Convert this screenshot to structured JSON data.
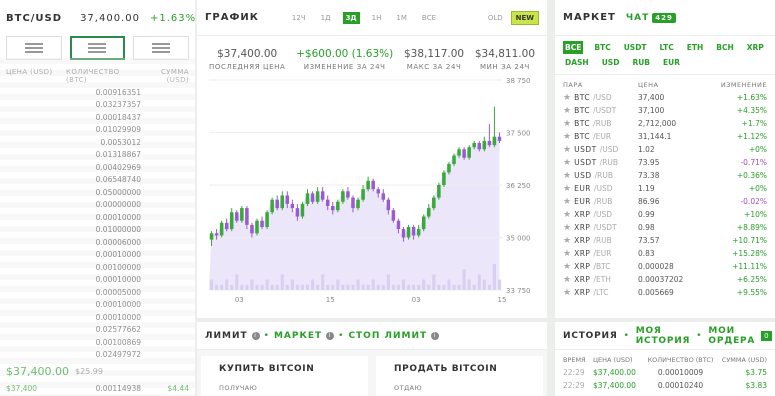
{
  "orderbook": {
    "pair": "BTC/USD",
    "price": "37,400.00",
    "change": "+1.63%",
    "columns": [
      "ЦЕНА (USD)",
      "КОЛИЧЕСТВО (BTC)",
      "СУММА (USD)"
    ],
    "rows": [
      {
        "q": "0.00916351"
      },
      {
        "q": "0.03237357"
      },
      {
        "q": "0.00018437"
      },
      {
        "q": "0.01029909"
      },
      {
        "q": "0.0053012"
      },
      {
        "q": "0.01318867"
      },
      {
        "q": "0.00402969"
      },
      {
        "q": "0.06548740"
      },
      {
        "q": "0.05000000"
      },
      {
        "q": "0.00000000"
      },
      {
        "q": "0.00010000"
      },
      {
        "q": "0.01000000"
      },
      {
        "q": "0.00006000"
      },
      {
        "q": "0.00010000"
      },
      {
        "q": "0.00100000"
      },
      {
        "q": "0.00010000"
      },
      {
        "q": "0.00005000"
      },
      {
        "q": "0.00010000"
      },
      {
        "q": "0.00010000"
      },
      {
        "q": "0.02577662"
      },
      {
        "q": "0.00100869"
      },
      {
        "q": "0.02497972"
      }
    ],
    "mid_price": "$37,400.00",
    "mid_usd": "$25.99",
    "bottom_row": {
      "p": "$37,400",
      "q": "0.00114938",
      "s": "$4.44"
    }
  },
  "chart_panel": {
    "title": "ГРАФИК",
    "ranges": [
      "12Ч",
      "1Д",
      "3Д",
      "1Н",
      "1М",
      "ВСЕ"
    ],
    "active_range": "3Д",
    "old_label": "OLD",
    "new_label": "NEW",
    "stats": [
      {
        "value": "$37,400.00",
        "label": "ПОСЛЕДНЯЯ ЦЕНА",
        "color": "#555"
      },
      {
        "value": "+$600.00 (1.63%)",
        "label": "ИЗМЕНЕНИЕ ЗА 24Ч",
        "color": "#28a028"
      },
      {
        "value": "$38,117.00",
        "label": "МАКС ЗА 24Ч",
        "color": "#555"
      },
      {
        "value": "$34,811.00",
        "label": "МИН ЗА 24Ч",
        "color": "#555"
      }
    ]
  },
  "chart_data": {
    "type": "candlestick",
    "yticks": [
      33750,
      35000,
      36250,
      37500,
      38750
    ],
    "ytick_labels": [
      "33 750",
      "35 000",
      "36 250",
      "37 500",
      "38 750"
    ],
    "ylim": [
      33750,
      38750
    ],
    "xticks": [
      "03",
      "15",
      "03",
      "15"
    ],
    "xtick_index": [
      6,
      24,
      41,
      58
    ],
    "candles": [
      [
        34950,
        35100,
        34800,
        35150
      ],
      [
        35100,
        35050,
        34950,
        35200
      ],
      [
        35050,
        35350,
        35000,
        35400
      ],
      [
        35350,
        35200,
        35150,
        35450
      ],
      [
        35200,
        35600,
        35150,
        35700
      ],
      [
        35600,
        35400,
        35350,
        35650
      ],
      [
        35400,
        35700,
        35350,
        35750
      ],
      [
        35700,
        35300,
        35200,
        35750
      ],
      [
        35300,
        35100,
        35000,
        35350
      ],
      [
        35100,
        35400,
        35050,
        35450
      ],
      [
        35400,
        35250,
        35200,
        35500
      ],
      [
        35250,
        35600,
        35200,
        35650
      ],
      [
        35600,
        35900,
        35550,
        35950
      ],
      [
        35900,
        35700,
        35650,
        36000
      ],
      [
        35700,
        36000,
        35650,
        36100
      ],
      [
        36000,
        35800,
        35700,
        36100
      ],
      [
        35800,
        35700,
        35600,
        35900
      ],
      [
        35700,
        35500,
        35400,
        35800
      ],
      [
        35500,
        35800,
        35450,
        35850
      ],
      [
        35800,
        36050,
        35750,
        36150
      ],
      [
        36050,
        35850,
        35800,
        36100
      ],
      [
        35850,
        36100,
        35800,
        36200
      ],
      [
        36100,
        35900,
        35850,
        36200
      ],
      [
        35900,
        35750,
        35650,
        36000
      ],
      [
        35750,
        35650,
        35550,
        35850
      ],
      [
        35650,
        35850,
        35600,
        35900
      ],
      [
        35850,
        36100,
        35800,
        36150
      ],
      [
        36100,
        35950,
        35900,
        36200
      ],
      [
        35950,
        35700,
        35600,
        36000
      ],
      [
        35700,
        35900,
        35650,
        35950
      ],
      [
        35900,
        36150,
        35850,
        36250
      ],
      [
        36150,
        36350,
        36100,
        36450
      ],
      [
        36350,
        36150,
        36100,
        36400
      ],
      [
        36150,
        36050,
        35950,
        36200
      ],
      [
        36050,
        35900,
        35850,
        36150
      ],
      [
        35900,
        35650,
        35550,
        35950
      ],
      [
        35650,
        35400,
        35350,
        35700
      ],
      [
        35400,
        35200,
        35100,
        35450
      ],
      [
        35200,
        35000,
        34900,
        35250
      ],
      [
        35000,
        35250,
        34950,
        35300
      ],
      [
        35250,
        35050,
        34950,
        35300
      ],
      [
        35050,
        35200,
        35000,
        35300
      ],
      [
        35200,
        35500,
        35150,
        35550
      ],
      [
        35500,
        35700,
        35450,
        35800
      ],
      [
        35700,
        35950,
        35650,
        36000
      ],
      [
        35950,
        36250,
        35900,
        36300
      ],
      [
        36250,
        36550,
        36200,
        36600
      ],
      [
        36550,
        36750,
        36500,
        36800
      ],
      [
        36750,
        36950,
        36700,
        37000
      ],
      [
        36950,
        37100,
        36900,
        37150
      ],
      [
        37100,
        36900,
        36850,
        37150
      ],
      [
        36900,
        37150,
        36850,
        37200
      ],
      [
        37150,
        37250,
        37100,
        37300
      ],
      [
        37250,
        37100,
        37050,
        37300
      ],
      [
        37100,
        37300,
        37050,
        37400
      ],
      [
        37300,
        37200,
        37150,
        37700
      ],
      [
        37200,
        37400,
        37150,
        38117
      ],
      [
        37400,
        37300,
        37250,
        37500
      ]
    ],
    "volumes": [
      2,
      1,
      1,
      2,
      1,
      3,
      1,
      1,
      2,
      1,
      1,
      2,
      1,
      1,
      3,
      1,
      2,
      1,
      1,
      1,
      2,
      1,
      3,
      1,
      1,
      2,
      1,
      1,
      1,
      2,
      1,
      1,
      2,
      1,
      1,
      3,
      1,
      1,
      2,
      1,
      1,
      1,
      2,
      1,
      3,
      1,
      1,
      2,
      1,
      1,
      4,
      2,
      1,
      3,
      2,
      1,
      5,
      2
    ]
  },
  "market": {
    "title": "МАРКЕТ",
    "chat_label": "ЧАТ",
    "chat_count": "429",
    "currencies": [
      "ВСЕ",
      "BTC",
      "USDT",
      "LTC",
      "ETH",
      "BCH",
      "XRP",
      "DASH",
      "USD",
      "RUB",
      "EUR"
    ],
    "active_currency": "ВСЕ",
    "columns": [
      "ПАРА",
      "ЦЕНА",
      "ИЗМЕНЕНИЕ"
    ],
    "rows": [
      {
        "base": "BTC",
        "quote": "/USD",
        "price": "37,400",
        "change": "+1.63%"
      },
      {
        "base": "BTC",
        "quote": "/USDT",
        "price": "37,100",
        "change": "+4.35%"
      },
      {
        "base": "BTC",
        "quote": "/RUB",
        "price": "2,712,000",
        "change": "+1.7%"
      },
      {
        "base": "BTC",
        "quote": "/EUR",
        "price": "31,144.1",
        "change": "+1.12%"
      },
      {
        "base": "USDT",
        "quote": "/USD",
        "price": "1.02",
        "change": "+0%"
      },
      {
        "base": "USDT",
        "quote": "/RUB",
        "price": "73.95",
        "change": "-0.71%"
      },
      {
        "base": "USD",
        "quote": "/RUB",
        "price": "73.38",
        "change": "+0.36%"
      },
      {
        "base": "EUR",
        "quote": "/USD",
        "price": "1.19",
        "change": "+0%"
      },
      {
        "base": "EUR",
        "quote": "/RUB",
        "price": "86.96",
        "change": "-0.02%"
      },
      {
        "base": "XRP",
        "quote": "/USD",
        "price": "0.99",
        "change": "+10%"
      },
      {
        "base": "XRP",
        "quote": "/USDT",
        "price": "0.98",
        "change": "+8.89%"
      },
      {
        "base": "XRP",
        "quote": "/RUB",
        "price": "73.57",
        "change": "+10.71%"
      },
      {
        "base": "XRP",
        "quote": "/EUR",
        "price": "0.83",
        "change": "+15.28%"
      },
      {
        "base": "XRP",
        "quote": "/BTC",
        "price": "0.000028",
        "change": "+11.11%"
      },
      {
        "base": "XRP",
        "quote": "/ETH",
        "price": "0.00037202",
        "change": "+6.25%"
      },
      {
        "base": "XRP",
        "quote": "/LTC",
        "price": "0.005669",
        "change": "+9.55%"
      }
    ]
  },
  "limit": {
    "tab_limit": "ЛИМИТ",
    "tab_market": "МАРКЕТ",
    "tab_stop": "СТОП ЛИМИТ",
    "buy_title": "КУПИТЬ BITCOIN",
    "buy_sub": "ПОЛУЧАЮ",
    "sell_title": "ПРОДАТЬ BITCOIN",
    "sell_sub": "ОТДАЮ"
  },
  "history": {
    "title": "ИСТОРИЯ",
    "my_history": "МОЯ ИСТОРИЯ",
    "my_orders": "МОИ ОРДЕРА",
    "orders_count": "0",
    "columns": [
      "ВРЕМЯ",
      "ЦЕНА (USD)",
      "КОЛИЧЕСТВО (BTC)",
      "СУММА (USD)"
    ],
    "rows": [
      {
        "time": "22:29",
        "price": "$37,400.00",
        "qty": "0.00010009",
        "sum": "$3.75"
      },
      {
        "time": "22:29",
        "price": "$37,400.00",
        "qty": "0.00010240",
        "sum": "$3.83"
      }
    ]
  }
}
